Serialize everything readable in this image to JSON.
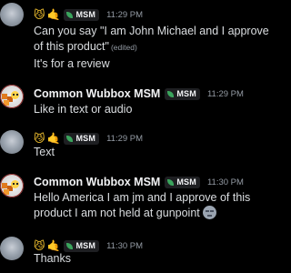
{
  "messages": [
    {
      "author_type": "user",
      "author_icons": [
        "😼",
        "🤙"
      ],
      "badge": "MSM",
      "time": "11:29 PM",
      "lines": [
        "Can you say \"I am John Michael and I approve of this product\""
      ],
      "edited": "(edited)"
    },
    {
      "continuation": "It's for a review"
    },
    {
      "author_type": "named",
      "username": "Common Wubbox MSM",
      "badge": "MSM",
      "time": "11:29 PM",
      "text": "Like in text or audio"
    },
    {
      "author_type": "user",
      "author_icons": [
        "😼",
        "🤙"
      ],
      "badge": "MSM",
      "time": "11:29 PM",
      "text": "Text"
    },
    {
      "author_type": "named",
      "username": "Common Wubbox MSM",
      "badge": "MSM",
      "time": "11:30 PM",
      "text": "Hello America I am jm and I approve of this product I am not held at gunpoint",
      "trailing_emoji": "neutral-face-emoji"
    },
    {
      "author_type": "user",
      "author_icons": [
        "😼",
        "🤙"
      ],
      "badge": "MSM",
      "time": "11:30 PM",
      "text": "Thanks"
    }
  ],
  "colors": {
    "background": "#000000",
    "username": "#f2f3f5",
    "message_text": "#dbdee1",
    "timestamp": "#949ba4",
    "badge_bg": "#1e1f22",
    "badge_leaf": "#3ba55d"
  }
}
